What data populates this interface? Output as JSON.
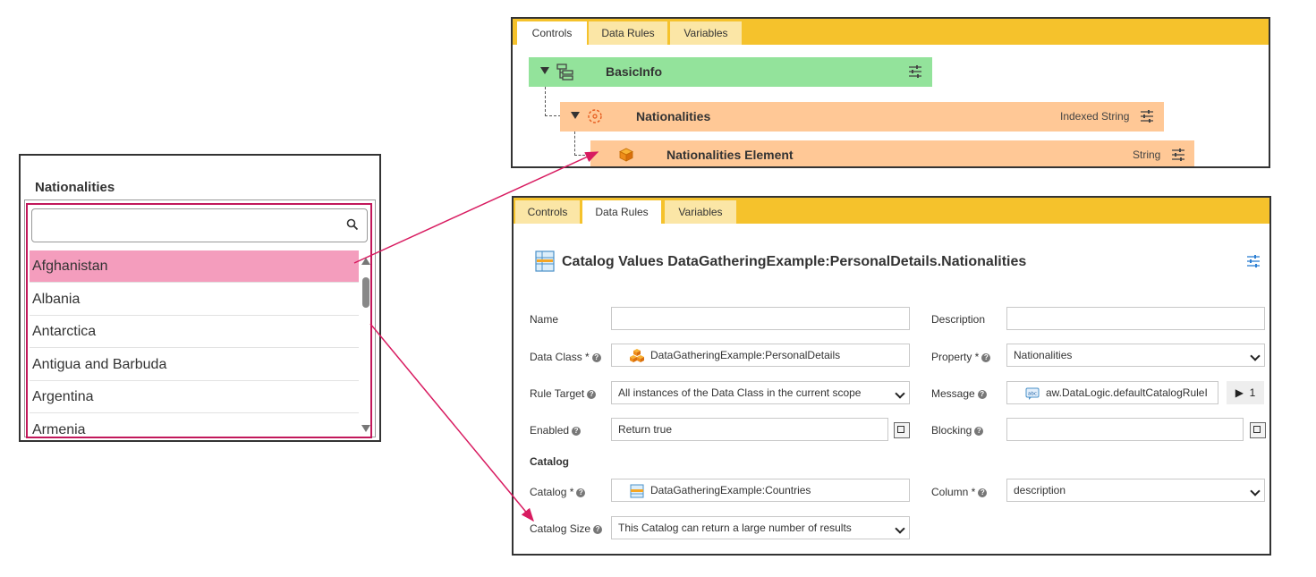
{
  "left_panel": {
    "title": "Nationalities",
    "search": {
      "value": "",
      "placeholder": ""
    },
    "options": [
      "Afghanistan",
      "Albania",
      "Antarctica",
      "Antigua and Barbuda",
      "Argentina",
      "Armenia"
    ],
    "selected_index": 0
  },
  "top_panel": {
    "tabs": [
      {
        "label": "Controls",
        "active": true
      },
      {
        "label": "Data Rules",
        "active": false
      },
      {
        "label": "Variables",
        "active": false
      }
    ],
    "tree": [
      {
        "name": "BasicInfo",
        "type": "",
        "icon": "structure-icon"
      },
      {
        "name": "Nationalities",
        "type": "Indexed String",
        "icon": "catalog-list-icon"
      },
      {
        "name": "Nationalities Element",
        "type": "String",
        "icon": "cube-icon"
      }
    ]
  },
  "bottom_panel": {
    "tabs": [
      {
        "label": "Controls",
        "active": false
      },
      {
        "label": "Data Rules",
        "active": true
      },
      {
        "label": "Variables",
        "active": false
      }
    ],
    "title": "Catalog Values DataGatheringExample:PersonalDetails.Nationalities",
    "fields": {
      "name": {
        "label": "Name",
        "value": ""
      },
      "description": {
        "label": "Description",
        "value": ""
      },
      "data_class": {
        "label": "Data Class *",
        "value": "DataGatheringExample:PersonalDetails"
      },
      "property": {
        "label": "Property *",
        "value": "Nationalities"
      },
      "rule_target": {
        "label": "Rule Target",
        "value": "All instances of the Data Class in the current scope"
      },
      "message": {
        "label": "Message",
        "value": "aw.DataLogic.defaultCatalogRuleI",
        "count": "1"
      },
      "enabled": {
        "label": "Enabled",
        "value": "Return true"
      },
      "blocking": {
        "label": "Blocking",
        "value": ""
      },
      "catalog_section": "Catalog",
      "catalog": {
        "label": "Catalog *",
        "value": "DataGatheringExample:Countries"
      },
      "column": {
        "label": "Column *",
        "value": "description"
      },
      "catalog_size": {
        "label": "Catalog Size",
        "value": "This Catalog can return a large number of results"
      }
    }
  },
  "colors": {
    "tab_bar": "#f5c22c",
    "tab_inactive": "#fbe6a6",
    "tree_group": "#93e39b",
    "tree_property": "#ffc896",
    "selection": "#f49dbd",
    "annotation": "#d81b60"
  }
}
